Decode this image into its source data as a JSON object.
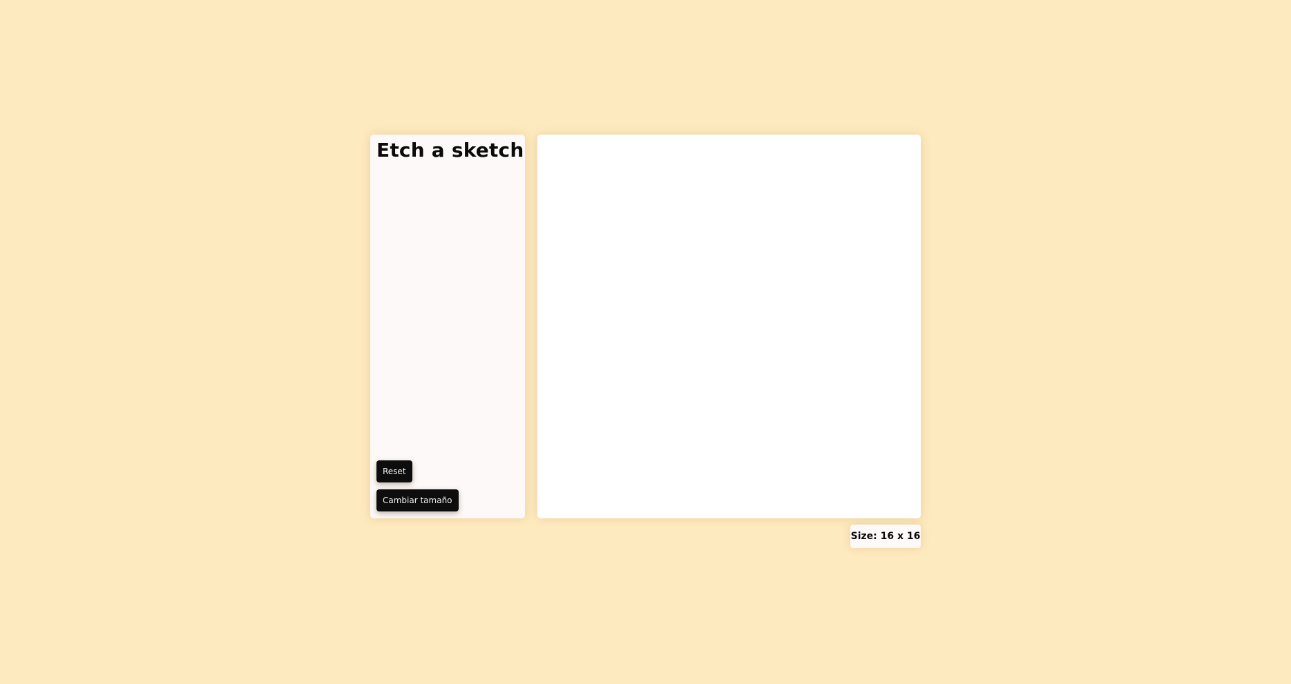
{
  "sidebar": {
    "title": "Etch a sketch",
    "reset_label": "Reset",
    "resize_label": "Cambiar tamaño"
  },
  "canvas": {
    "grid_columns": 16,
    "grid_rows": 16,
    "cell_color": "#ffffff"
  },
  "status": {
    "size_text": "Size: 16 x 16"
  },
  "colors": {
    "page_background": "#feeabf",
    "panel_background": "#fdf9f8",
    "button_background": "#0d0d0d",
    "button_text": "#f2f2f2"
  }
}
